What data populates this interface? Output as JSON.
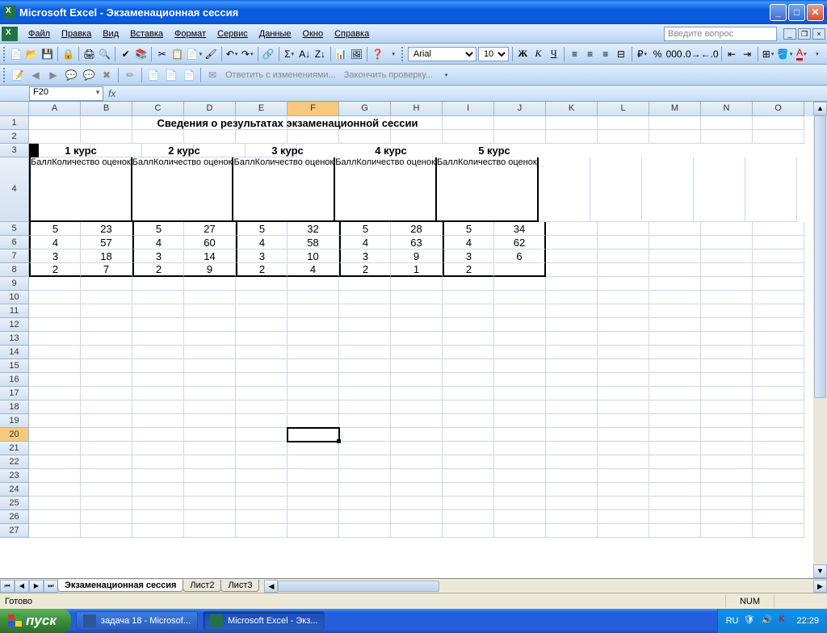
{
  "titlebar": {
    "text": "Microsoft Excel - Экзаменационная сессия"
  },
  "menu": {
    "file": "Файл",
    "edit": "Правка",
    "view": "Вид",
    "insert": "Вставка",
    "format": "Формат",
    "tools": "Сервис",
    "data": "Данные",
    "window": "Окно",
    "help": "Справка",
    "question_placeholder": "Введите вопрос"
  },
  "formatting": {
    "font": "Arial",
    "size": "10",
    "bold": "Ж",
    "italic": "К",
    "underline": "Ч"
  },
  "review": {
    "respond": "Ответить с изменениями...",
    "finish": "Закончить проверку..."
  },
  "namebox": "F20",
  "columns": [
    "A",
    "B",
    "C",
    "D",
    "E",
    "F",
    "G",
    "H",
    "I",
    "J",
    "K",
    "L",
    "M",
    "N",
    "O"
  ],
  "active_col_index": 5,
  "rows": [
    "1",
    "2",
    "3",
    "4",
    "5",
    "6",
    "7",
    "8",
    "9",
    "10",
    "11",
    "12",
    "13",
    "14",
    "15",
    "16",
    "17",
    "18",
    "19",
    "20",
    "21",
    "22",
    "23",
    "24",
    "25",
    "26",
    "27"
  ],
  "active_row_index": 19,
  "tall_row_index": 3,
  "sheet": {
    "title": "Сведения о результатах экзаменационной сессии",
    "courses": [
      "1 курс",
      "2 курс",
      "3 курс",
      "4 курс",
      "5 курс"
    ],
    "col_ball": "Балл",
    "col_count": "Количество оценок",
    "data": [
      [
        "5",
        "23",
        "5",
        "27",
        "5",
        "32",
        "5",
        "28",
        "5",
        "34"
      ],
      [
        "4",
        "57",
        "4",
        "60",
        "4",
        "58",
        "4",
        "63",
        "4",
        "62"
      ],
      [
        "3",
        "18",
        "3",
        "14",
        "3",
        "10",
        "3",
        "9",
        "3",
        "6"
      ],
      [
        "2",
        "7",
        "2",
        "9",
        "2",
        "4",
        "2",
        "1",
        "2",
        ""
      ]
    ]
  },
  "tabs": {
    "nav": [
      "⏮",
      "◀",
      "▶",
      "⏭"
    ],
    "sheets": [
      "Экзаменационная сессия",
      "Лист2",
      "Лист3"
    ],
    "active": 0
  },
  "status": {
    "ready": "Готово",
    "num": "NUM"
  },
  "taskbar": {
    "start": "пуск",
    "tasks": [
      {
        "label": "задача 18 - Microsof...",
        "type": "word"
      },
      {
        "label": "Microsoft Excel - Экз...",
        "type": "excel"
      }
    ],
    "lang": "RU",
    "time": "22:29"
  },
  "chart_data": {
    "type": "table",
    "title": "Сведения о результатах экзаменационной сессии",
    "columns": [
      "Балл",
      "Количество оценок"
    ],
    "groups": [
      "1 курс",
      "2 курс",
      "3 курс",
      "4 курс",
      "5 курс"
    ],
    "rows": [
      {
        "Балл": 5,
        "1 курс": 23,
        "2 курс": 27,
        "3 курс": 32,
        "4 курс": 28,
        "5 курс": 34
      },
      {
        "Балл": 4,
        "1 курс": 57,
        "2 курс": 60,
        "3 курс": 58,
        "4 курс": 63,
        "5 курс": 62
      },
      {
        "Балл": 3,
        "1 курс": 18,
        "2 курс": 14,
        "3 курс": 10,
        "4 курс": 9,
        "5 курс": 6
      },
      {
        "Балл": 2,
        "1 курс": 7,
        "2 курс": 9,
        "3 курс": 4,
        "4 курс": 1,
        "5 курс": null
      }
    ]
  }
}
